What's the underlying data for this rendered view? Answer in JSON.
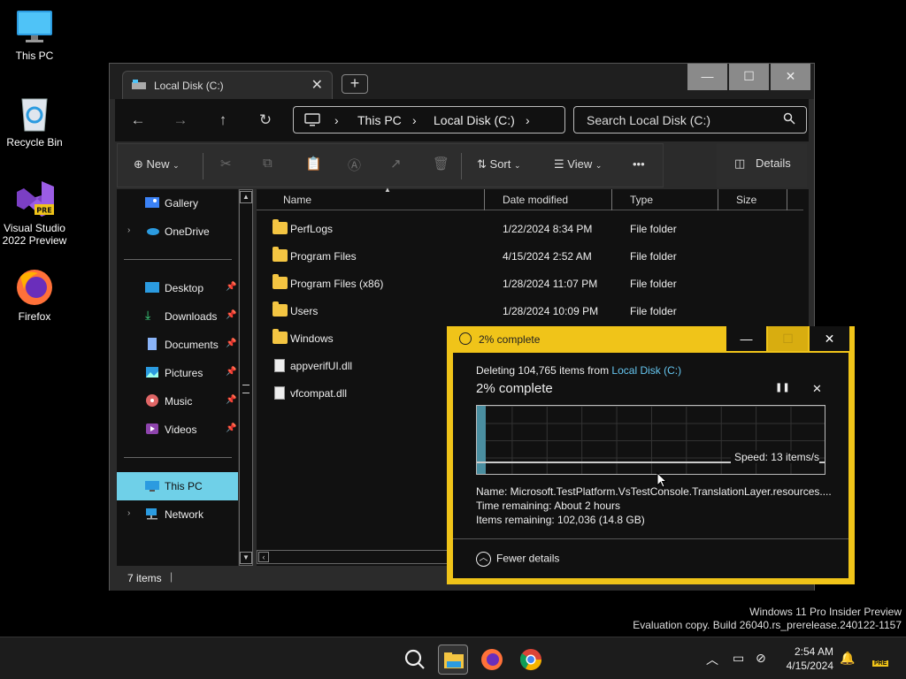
{
  "desktop": {
    "icons": [
      {
        "label": "This PC"
      },
      {
        "label": "Recycle Bin"
      },
      {
        "label": "Visual Studio 2022 Preview",
        "badge": "PRE"
      },
      {
        "label": "Firefox"
      }
    ]
  },
  "explorer": {
    "tab_title": "Local Disk (C:)",
    "tab_close": "✕",
    "new_tab": "+",
    "window_controls": {
      "minimize": "—",
      "maximize": "☐",
      "close": "✕"
    },
    "nav": {
      "back": "←",
      "forward": "→",
      "up": "↑",
      "refresh": "↻"
    },
    "breadcrumb": [
      "This PC",
      "Local Disk (C:)"
    ],
    "breadcrumb_sep": "›",
    "search_placeholder": "Search Local Disk (C:)",
    "commands": {
      "new": "New",
      "sort": "Sort",
      "view": "View",
      "more": "•••",
      "details": "Details"
    },
    "sidebar": {
      "items": [
        {
          "label": "Gallery"
        },
        {
          "label": "OneDrive"
        },
        {
          "label": "Desktop"
        },
        {
          "label": "Downloads"
        },
        {
          "label": "Documents"
        },
        {
          "label": "Pictures"
        },
        {
          "label": "Music"
        },
        {
          "label": "Videos"
        },
        {
          "label": "This PC"
        },
        {
          "label": "Network"
        }
      ],
      "pin": "📌"
    },
    "columns": {
      "name": "Name",
      "date": "Date modified",
      "type": "Type",
      "size": "Size"
    },
    "files": [
      {
        "name": "PerfLogs",
        "date": "1/22/2024 8:34 PM",
        "type": "File folder"
      },
      {
        "name": "Program Files",
        "date": "4/15/2024 2:52 AM",
        "type": "File folder"
      },
      {
        "name": "Program Files (x86)",
        "date": "1/28/2024 11:07 PM",
        "type": "File folder"
      },
      {
        "name": "Users",
        "date": "1/28/2024 10:09 PM",
        "type": "File folder"
      },
      {
        "name": "Windows",
        "date": "",
        "type": ""
      },
      {
        "name": "appverifUI.dll",
        "date": "",
        "type": ""
      },
      {
        "name": "vfcompat.dll",
        "date": "",
        "type": ""
      }
    ],
    "status": "7 items"
  },
  "dialog": {
    "title": "2% complete",
    "deleting_prefix": "Deleting 104,765 items from",
    "deleting_link": "Local Disk (C:)",
    "heading": "2% complete",
    "progress_fraction": 0.02,
    "speed": "Speed: 13 items/s",
    "name_line": "Name:  Microsoft.TestPlatform.VsTestConsole.TranslationLayer.resources....",
    "time_line": "Time remaining:  About 2 hours",
    "items_line": "Items remaining:  102,036 (14.8 GB)",
    "fewer_details": "Fewer details",
    "controls": {
      "pause": "❚❚",
      "cancel": "✕",
      "minimize": "—",
      "maximize": "☐",
      "close": "✕"
    }
  },
  "watermark": {
    "line1": "Windows 11 Pro Insider Preview",
    "line2": "Evaluation copy. Build 26040.rs_prerelease.240122-1157"
  },
  "taskbar": {
    "time": "2:54 AM",
    "date": "4/15/2024",
    "badge": "PRE"
  }
}
